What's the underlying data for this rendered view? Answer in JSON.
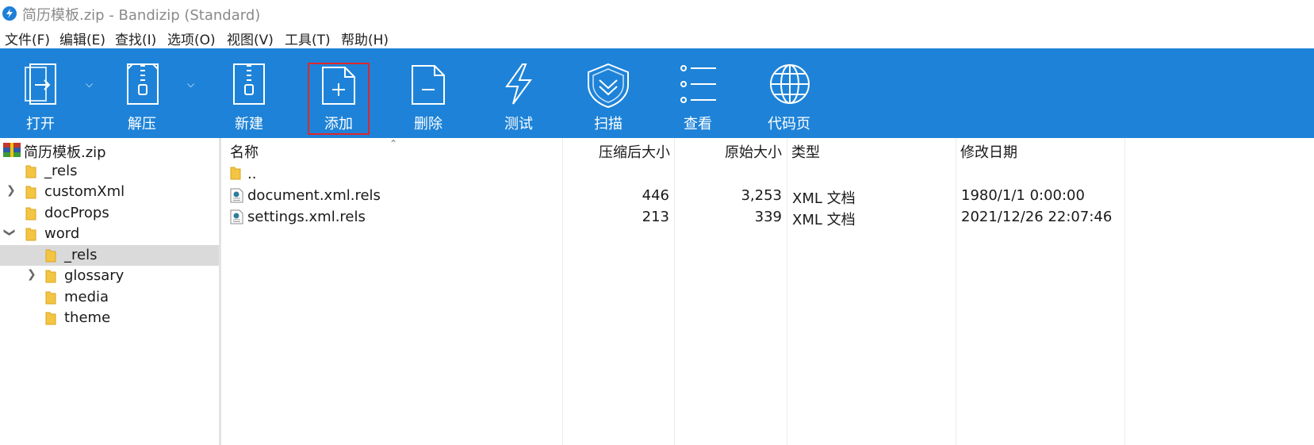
{
  "window": {
    "title": "简历模板.zip - Bandizip (Standard)"
  },
  "menu": [
    "文件(F)",
    "编辑(E)",
    "查找(I)",
    "选项(O)",
    "视图(V)",
    "工具(T)",
    "帮助(H)"
  ],
  "toolbar": {
    "open": "打开",
    "extract": "解压",
    "new": "新建",
    "add": "添加",
    "delete": "删除",
    "test": "测试",
    "scan": "扫描",
    "view": "查看",
    "codepage": "代码页"
  },
  "tree": {
    "root": "简历模板.zip",
    "items": [
      "_rels",
      "customXml",
      "docProps",
      "word",
      "_rels",
      "glossary",
      "media",
      "theme"
    ]
  },
  "list": {
    "columns": {
      "name": "名称",
      "compressed": "压缩后大小",
      "original": "原始大小",
      "type": "类型",
      "modified": "修改日期"
    },
    "parent": "..",
    "rows": [
      {
        "name": "document.xml.rels",
        "compressed": "446",
        "original": "3,253",
        "type": "XML 文档",
        "modified": "1980/1/1 0:00:00"
      },
      {
        "name": "settings.xml.rels",
        "compressed": "213",
        "original": "339",
        "type": "XML 文档",
        "modified": "2021/12/26 22:07:46"
      }
    ]
  },
  "colors": {
    "toolbar": "#1e83d8",
    "selection": "#dadada",
    "highlight": "#e0262b",
    "folder": "#f4c542"
  }
}
